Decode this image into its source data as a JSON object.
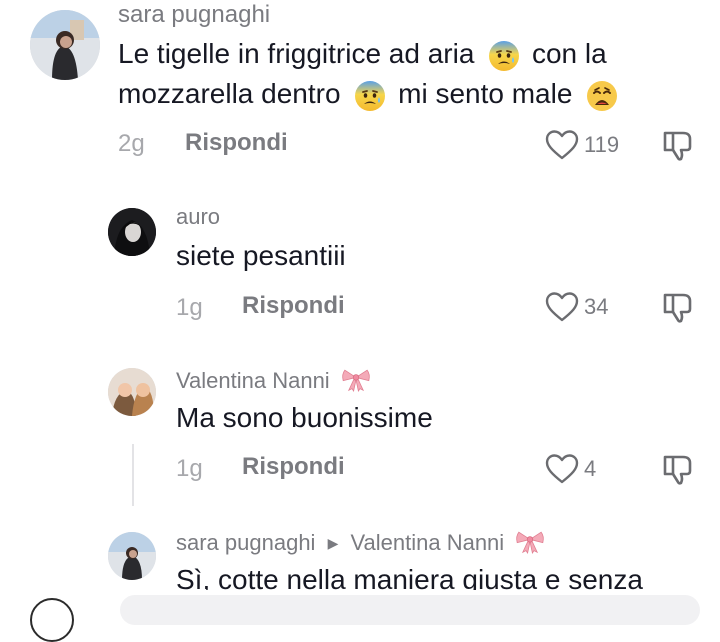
{
  "comments": [
    {
      "username": "sara pugnaghi",
      "text_line1": "Le tigelle in friggitrice ad aria",
      "text_line1b": "con la",
      "text_line2": "mozzarella dentro",
      "text_line2b": "mi sento male",
      "time": "2g",
      "reply_label": "Rispondi",
      "likes": "119"
    },
    {
      "username": "auro",
      "text": "siete pesantiii",
      "time": "1g",
      "reply_label": "Rispondi",
      "likes": "34"
    },
    {
      "username": "Valentina Nanni",
      "text": "Ma sono buonissime",
      "time": "1g",
      "reply_label": "Rispondi",
      "likes": "4"
    },
    {
      "username": "sara pugnaghi",
      "reply_to": "Valentina Nanni",
      "text": "Sì, cotte nella maniera giusta e senza"
    }
  ],
  "icons": {
    "like": "heart-outline-icon",
    "dislike": "thumbs-down-icon",
    "emoji_anxious": "anxious-face-emoji",
    "emoji_weary": "weary-face-emoji",
    "emoji_bow": "ribbon-bow-emoji",
    "reply_arrow": "triangle-right-icon"
  },
  "colors": {
    "username": "#7a7b80",
    "text": "#161823",
    "time": "#a7a8ac",
    "bow": "#f2a7b5"
  }
}
